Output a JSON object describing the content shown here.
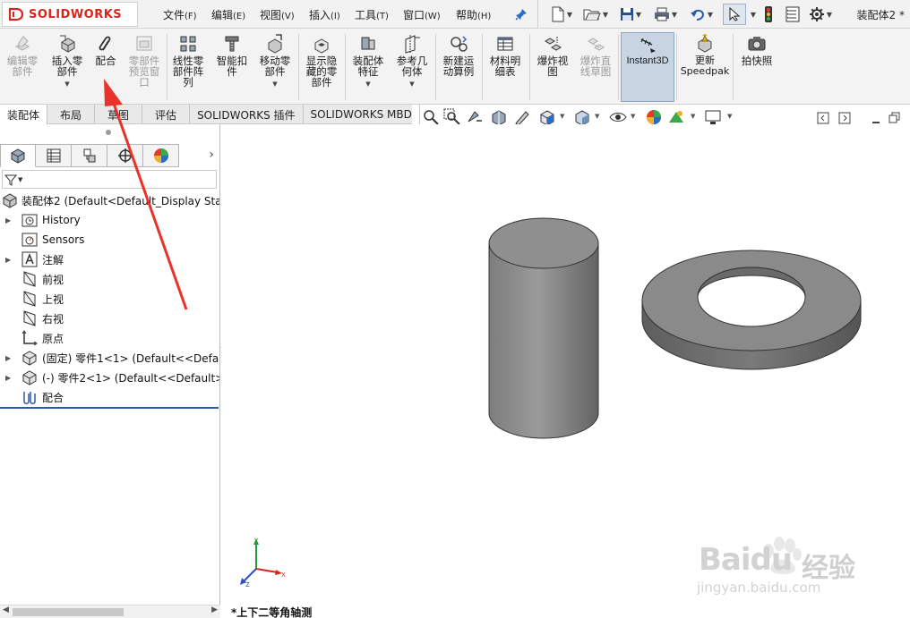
{
  "app": {
    "logo_text": "SOLIDWORKS",
    "document_title": "装配体2 *"
  },
  "menu": [
    {
      "label": "文件",
      "hotkey": "(F)"
    },
    {
      "label": "编辑",
      "hotkey": "(E)"
    },
    {
      "label": "视图",
      "hotkey": "(V)"
    },
    {
      "label": "插入",
      "hotkey": "(I)"
    },
    {
      "label": "工具",
      "hotkey": "(T)"
    },
    {
      "label": "窗口",
      "hotkey": "(W)"
    },
    {
      "label": "帮助",
      "hotkey": "(H)"
    }
  ],
  "ribbon": {
    "edit_component": "编辑零\n部件",
    "insert_components": "插入零\n部件",
    "mate": "配合",
    "component_preview": "零部件\n预览窗\n口",
    "linear_pattern": "线性零\n部件阵\n列",
    "smart_fasteners": "智能扣\n件",
    "move_component": "移动零\n部件",
    "show_hidden": "显示隐\n藏的零\n部件",
    "assembly_features": "装配体\n特征",
    "reference_geometry": "参考几\n何体",
    "new_motion_study": "新建运\n动算例",
    "bill_of_materials": "材料明\n细表",
    "exploded_view": "爆炸视\n图",
    "explode_line_sketch": "爆炸直\n线草图",
    "instant3d": "Instant3D",
    "update_speedpak": "更新\nSpeedpak",
    "snapshot": "拍快照"
  },
  "tabs": [
    "装配体",
    "布局",
    "草图",
    "评估",
    "SOLIDWORKS 插件",
    "SOLIDWORKS MBD"
  ],
  "tree": {
    "root": "装配体2  (Default<Default_Display Stat",
    "items": [
      {
        "label": "History",
        "expandable": true
      },
      {
        "label": "Sensors",
        "expandable": false
      },
      {
        "label": "注解",
        "expandable": true
      },
      {
        "label": "前视",
        "expandable": false
      },
      {
        "label": "上视",
        "expandable": false
      },
      {
        "label": "右视",
        "expandable": false
      },
      {
        "label": "原点",
        "expandable": false
      },
      {
        "label": "(固定) 零件1<1> (Default<<Defaul",
        "expandable": true
      },
      {
        "label": "(-) 零件2<1> (Default<<Default>_",
        "expandable": true
      },
      {
        "label": "配合",
        "expandable": false
      }
    ]
  },
  "viewport": {
    "view_orientation": "*上下二等角轴测",
    "triad": {
      "x": "X",
      "y": "Y",
      "z": "Z"
    }
  },
  "watermark": {
    "brand": "Baidu",
    "cn": "经验",
    "url": "jingyan.baidu.com"
  },
  "colors": {
    "accent_red": "#d9261c",
    "selection_blue": "#2a5aa8",
    "instant3d_bg": "#c8d4e2",
    "model_gray": "#8a8a8a",
    "annotation_arrow": "#e8332a"
  }
}
